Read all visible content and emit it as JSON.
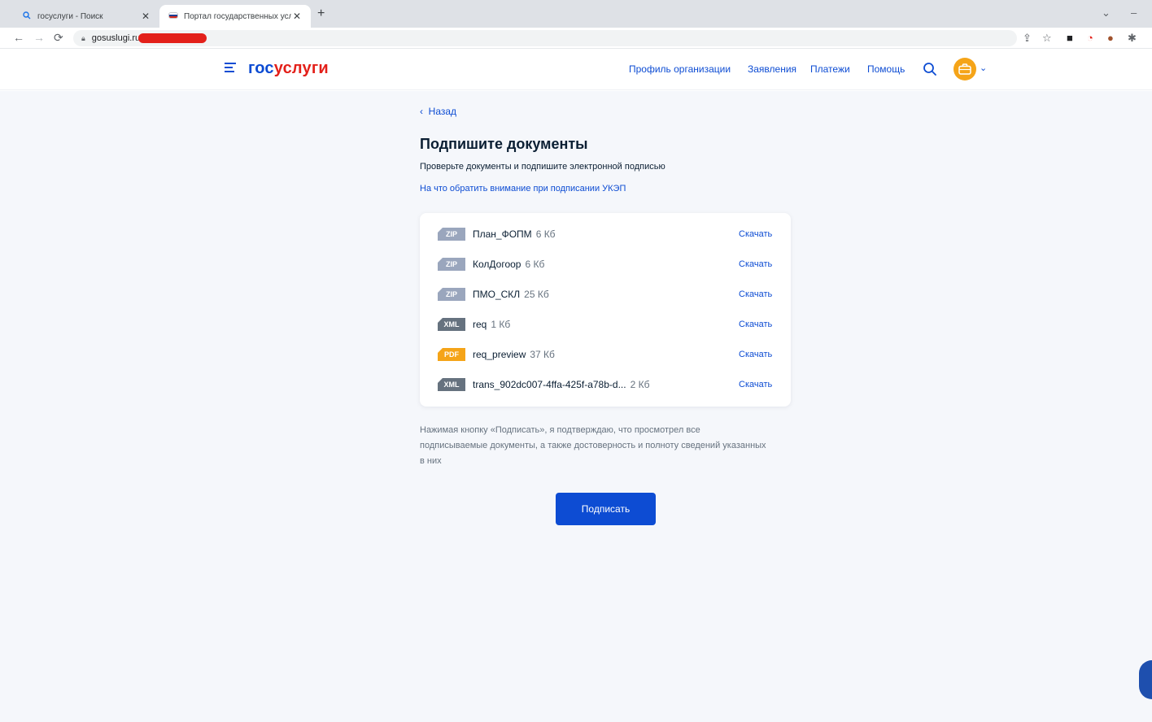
{
  "browser": {
    "tabs": [
      {
        "title": "госуслуги - Поиск",
        "icon": "search-icon"
      },
      {
        "title": "Портал государственных услуг",
        "icon": "russian-flag-icon"
      }
    ],
    "url": "gosuslugi.ru"
  },
  "header": {
    "logo_part1": "гос",
    "logo_part2": "услуги",
    "nav": [
      "Профиль организации",
      "Заявления",
      "Платежи",
      "Помощь"
    ]
  },
  "main": {
    "back": "Назад",
    "title": "Подпишите документы",
    "subtitle": "Проверьте документы и подпишите электронной подписью",
    "hint_link": "На что обратить внимание при подписании УКЭП",
    "documents": [
      {
        "type": "ZIP",
        "name": "План_ФОПМ",
        "size": "6 Кб",
        "action": "Скачать"
      },
      {
        "type": "ZIP",
        "name": "КолДогоор",
        "size": "6 Кб",
        "action": "Скачать"
      },
      {
        "type": "ZIP",
        "name": "ПМО_СКЛ",
        "size": "25 Кб",
        "action": "Скачать"
      },
      {
        "type": "XML",
        "name": "req",
        "size": "1 Кб",
        "action": "Скачать"
      },
      {
        "type": "PDF",
        "name": "req_preview",
        "size": "37 Кб",
        "action": "Скачать"
      },
      {
        "type": "XML",
        "name": "trans_902dc007-4ffa-425f-a78b-d...",
        "size": "2 Кб",
        "action": "Скачать"
      }
    ],
    "consent": "Нажимая кнопку «Подписать», я подтверждаю, что просмотрел все подписываемые документы, а также достоверность и полноту сведений указанных в них",
    "sign_button": "Подписать"
  },
  "colors": {
    "primary": "#0d4cd3",
    "accent_red": "#e3201a",
    "pdf_badge": "#f5a418",
    "xml_badge": "#66727f",
    "zip_badge": "#9aa6bd",
    "background": "#f5f7fb"
  }
}
